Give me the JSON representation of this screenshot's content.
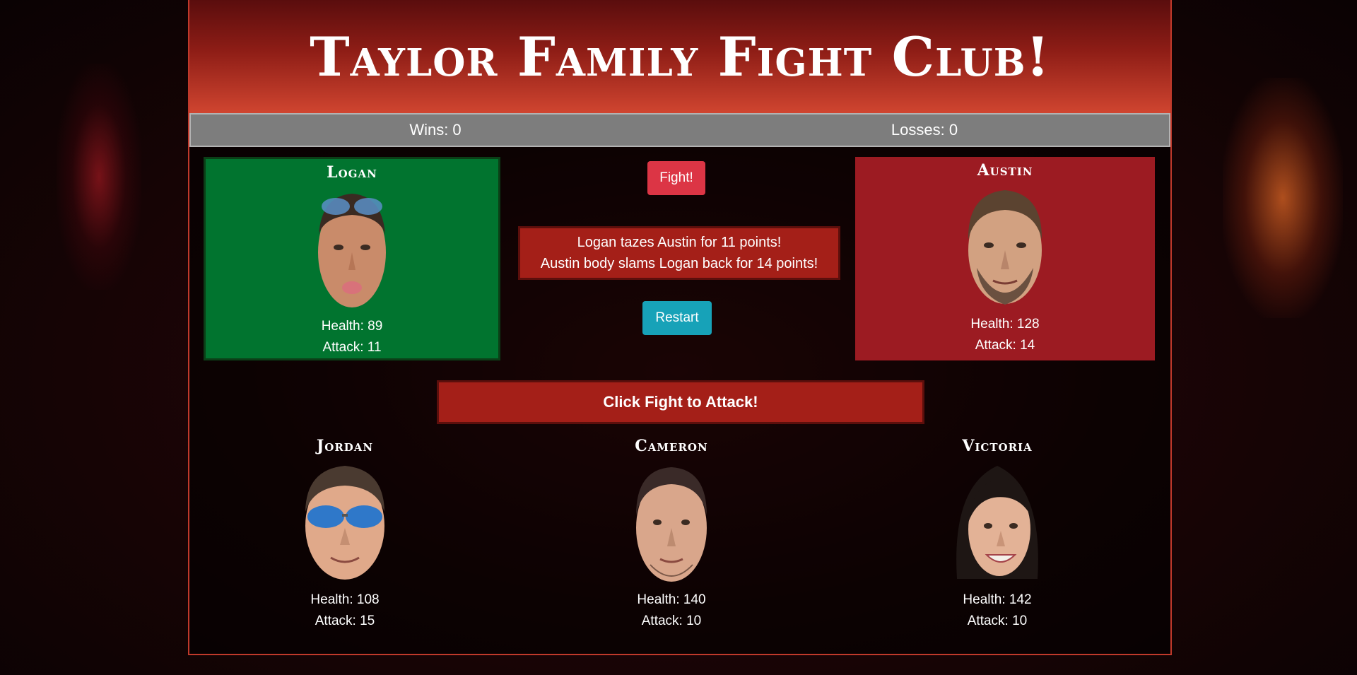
{
  "title": "Taylor Family Fight Club!",
  "score": {
    "wins": "Wins: 0",
    "losses": "Losses: 0"
  },
  "player": {
    "name": "Logan",
    "health": "Health: 89",
    "attack": "Attack: 11"
  },
  "defender": {
    "name": "Austin",
    "health": "Health: 128",
    "attack": "Attack: 14"
  },
  "controls": {
    "fight_label": "Fight!",
    "restart_label": "Restart"
  },
  "battle_log": {
    "line1": "Logan tazes Austin for 11 points!",
    "line2": "Austin body slams Logan back for 14 points!"
  },
  "banner": "Click Fight to Attack!",
  "bench": [
    {
      "name": "Jordan",
      "health": "Health: 108",
      "attack": "Attack: 15"
    },
    {
      "name": "Cameron",
      "health": "Health: 140",
      "attack": "Attack: 10"
    },
    {
      "name": "Victoria",
      "health": "Health: 142",
      "attack": "Attack: 10"
    }
  ],
  "colors": {
    "player_card": "#01742f",
    "enemy_card": "#9c1b22",
    "fight_button": "#dc3545",
    "restart_button": "#17a2b8",
    "log_box": "#a41f18"
  }
}
